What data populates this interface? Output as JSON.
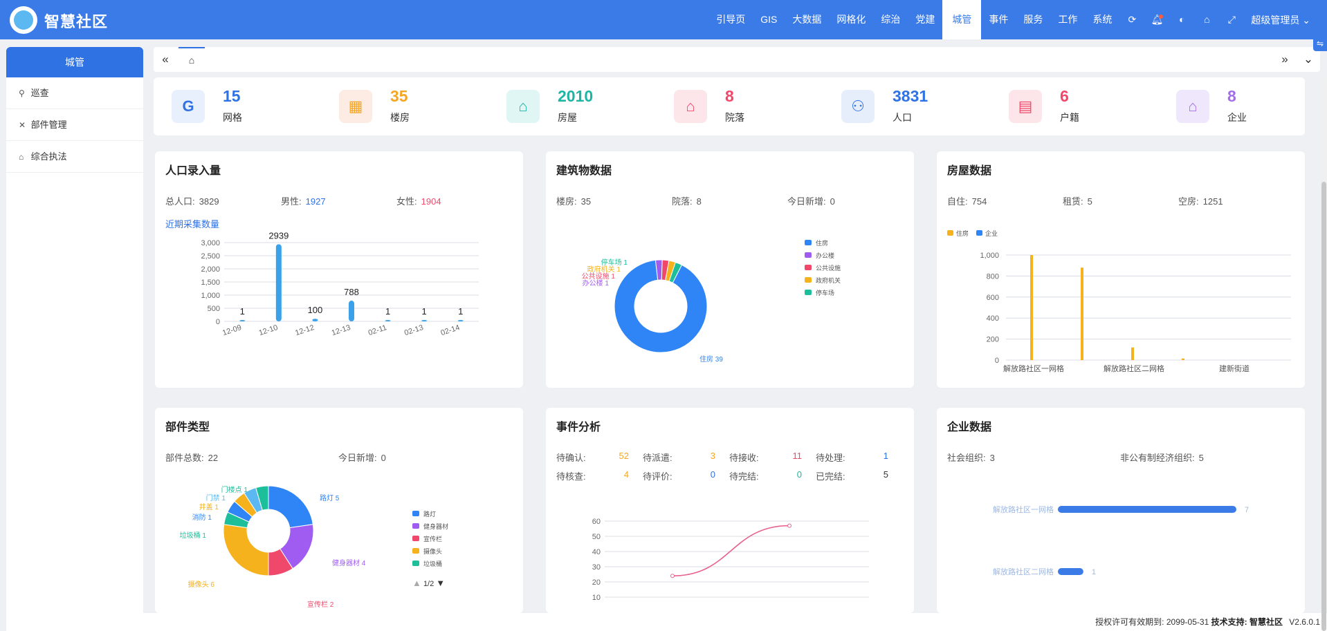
{
  "app": {
    "title": "智慧社区"
  },
  "nav": {
    "items": [
      "引导页",
      "GIS",
      "大数据",
      "网格化",
      "综治",
      "党建",
      "城管",
      "事件",
      "服务",
      "工作",
      "系统"
    ],
    "active": "城管",
    "user": "超级管理员"
  },
  "sidebar": {
    "title": "城管",
    "items": [
      {
        "label": "巡查",
        "icon": "location-icon"
      },
      {
        "label": "部件管理",
        "icon": "tools-icon"
      },
      {
        "label": "综合执法",
        "icon": "home-icon"
      }
    ]
  },
  "stats": [
    {
      "value": "15",
      "label": "网格",
      "icon": "G",
      "color": "#2f72e4",
      "bg": "#e8f0fd"
    },
    {
      "value": "35",
      "label": "楼房",
      "icon": "building-icon",
      "color": "#f5a623",
      "bg": "#fdece3"
    },
    {
      "value": "2010",
      "label": "房屋",
      "icon": "house-icon",
      "color": "#1db5a3",
      "bg": "#dff6f4"
    },
    {
      "value": "8",
      "label": "院落",
      "icon": "courtyard-icon",
      "color": "#f0486a",
      "bg": "#fde6ea"
    },
    {
      "value": "3831",
      "label": "人口",
      "icon": "people-icon",
      "color": "#2f72e4",
      "bg": "#e6eefc"
    },
    {
      "value": "6",
      "label": "户籍",
      "icon": "id-card-icon",
      "color": "#f0486a",
      "bg": "#fde6ea"
    },
    {
      "value": "8",
      "label": "企业",
      "icon": "bank-icon",
      "color": "#a46ee8",
      "bg": "#efe7fc"
    }
  ],
  "population": {
    "title": "人口录入量",
    "total_label": "总人口:",
    "total": "3829",
    "male_label": "男性:",
    "male": "1927",
    "female_label": "女性:",
    "female": "1904",
    "link": "近期采集数量"
  },
  "building": {
    "title": "建筑物数据",
    "floors_label": "楼房:",
    "floors": "35",
    "yards_label": "院落:",
    "yards": "8",
    "today_label": "今日新增:",
    "today": "0"
  },
  "housing": {
    "title": "房屋数据",
    "self_label": "自住:",
    "self": "754",
    "rent_label": "租赁:",
    "rent": "5",
    "empty_label": "空房:",
    "empty": "1251"
  },
  "parts": {
    "title": "部件类型",
    "total_label": "部件总数:",
    "total": "22",
    "today_label": "今日新增:",
    "today": "0",
    "pager": "1/2"
  },
  "events": {
    "title": "事件分析",
    "cells": [
      {
        "label": "待确认:",
        "value": "52",
        "color": "#f5a623"
      },
      {
        "label": "待派遣:",
        "value": "3",
        "color": "#f5a623"
      },
      {
        "label": "待接收:",
        "value": "11",
        "color": "#f0486a"
      },
      {
        "label": "待处理:",
        "value": "1",
        "color": "#2f72e4"
      },
      {
        "label": "待核查:",
        "value": "4",
        "color": "#f5a623"
      },
      {
        "label": "待评价:",
        "value": "0",
        "color": "#2f72e4"
      },
      {
        "label": "待完结:",
        "value": "0",
        "color": "#1db5a3"
      },
      {
        "label": "已完结:",
        "value": "5",
        "color": "#333333"
      }
    ]
  },
  "enterprise": {
    "title": "企业数据",
    "social_label": "社会组织:",
    "social": "3",
    "nonpublic_label": "非公有制经济组织:",
    "nonpublic": "5"
  },
  "footer": {
    "license_label": "授权许可有效期到:",
    "license_date": "2099-05-31",
    "support_label": "技术支持:",
    "support": "智慧社区",
    "version": "V2.6.0.1"
  },
  "chart_data": [
    {
      "type": "bar",
      "categories": [
        "12-09",
        "12-10",
        "12-12",
        "12-13",
        "02-11",
        "02-13",
        "02-14"
      ],
      "values": [
        1,
        2939,
        100,
        788,
        1,
        1,
        1
      ],
      "ylim": [
        0,
        3000
      ],
      "yticks": [
        "0",
        "500",
        "1,000",
        "1,500",
        "2,000",
        "2,500",
        "3,000"
      ],
      "color": "#3ba1e8"
    },
    {
      "type": "pie",
      "slices": [
        {
          "name": "住房",
          "value": 39,
          "color": "#2f85f5"
        },
        {
          "name": "办公楼",
          "value": 1,
          "color": "#a05cf0"
        },
        {
          "name": "公共设施",
          "value": 1,
          "color": "#f0486a"
        },
        {
          "name": "政府机关",
          "value": 1,
          "color": "#f5b21d"
        },
        {
          "name": "停车场",
          "value": 1,
          "color": "#1dbf9a"
        }
      ],
      "legend": "right"
    },
    {
      "type": "bar",
      "categories": [
        "解放路社区一网格",
        "解放路社区二网格",
        "建新街道"
      ],
      "series": [
        {
          "name": "住房",
          "color": "#f5b21d",
          "values": [
            1000,
            880,
            120,
            15
          ]
        },
        {
          "name": "企业",
          "color": "#2f85f5",
          "values": [
            0,
            0,
            0,
            0
          ]
        }
      ],
      "ylim": [
        0,
        1000
      ],
      "yticks": [
        "0",
        "200",
        "400",
        "600",
        "800",
        "1,000"
      ],
      "legend": "top-left"
    },
    {
      "type": "pie",
      "slices": [
        {
          "name": "路灯",
          "value": 5,
          "color": "#2f85f5"
        },
        {
          "name": "健身器材",
          "value": 4,
          "color": "#a05cf0"
        },
        {
          "name": "宣传栏",
          "value": 2,
          "color": "#f0486a"
        },
        {
          "name": "摄像头",
          "value": 6,
          "color": "#f5b21d"
        },
        {
          "name": "垃圾桶",
          "value": 1,
          "color": "#1dbf9a"
        },
        {
          "name": "消防",
          "value": 1,
          "color": "#2f85f5"
        },
        {
          "name": "井盖",
          "value": 1,
          "color": "#f5b21d"
        },
        {
          "name": "门禁",
          "value": 1,
          "color": "#5bb8f0"
        },
        {
          "name": "门楼点",
          "value": 1,
          "color": "#1dbf9a"
        }
      ],
      "legend_items": [
        "路灯",
        "健身器材",
        "宣传栏",
        "摄像头",
        "垃圾桶"
      ],
      "legend": "right"
    },
    {
      "type": "line",
      "points": [
        [
          0,
          24
        ],
        [
          1,
          57
        ]
      ],
      "ylim": [
        10,
        60
      ],
      "yticks": [
        "10",
        "20",
        "30",
        "40",
        "50",
        "60"
      ],
      "color": "#e8618c"
    },
    {
      "type": "bar",
      "orientation": "horizontal",
      "categories": [
        "解放路社区一网格",
        "解放路社区二网格"
      ],
      "values": [
        7,
        1
      ],
      "color": "#3b7be8"
    }
  ]
}
